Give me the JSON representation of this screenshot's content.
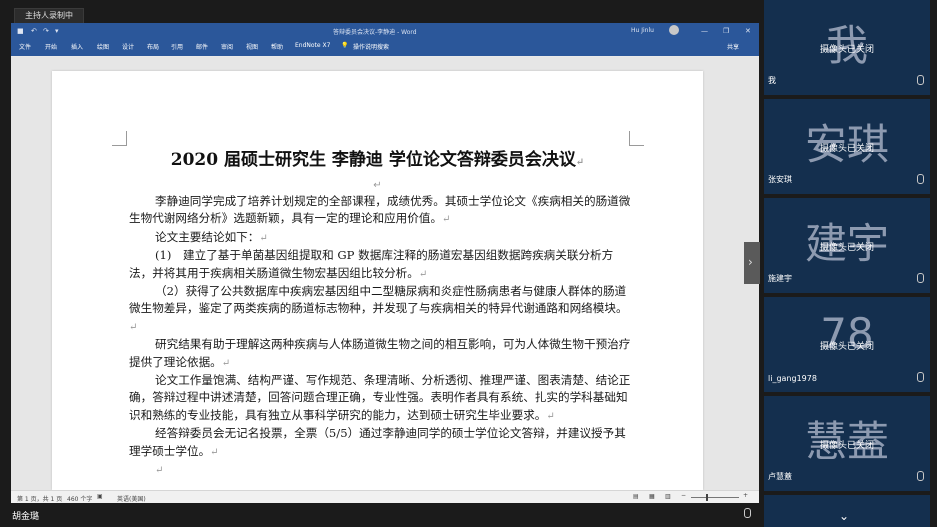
{
  "host_tab": "主持人录制中",
  "word": {
    "title": "答辩委员会决议-李静迪 - Word",
    "user": "Hu Jinlu",
    "share": "共享",
    "menu": [
      "文件",
      "开始",
      "插入",
      "绘图",
      "设计",
      "布局",
      "引用",
      "邮件",
      "审阅",
      "视图",
      "帮助",
      "EndNote X7"
    ],
    "tell_me": "操作说明搜索"
  },
  "document": {
    "title": "2020 届硕士研究生 李静迪 学位论文答辩委员会决议",
    "paragraphs": [
      "李静迪同学完成了培养计划规定的全部课程，成绩优秀。其硕士学位论文《疾病相关的肠道微生物代谢网络分析》选题新颖，具有一定的理论和应用价值。",
      "论文主要结论如下：",
      "(1)　建立了基于单菌基因组提取和 GP 数据库注释的肠道宏基因组数据跨疾病关联分析方法，并将其用于疾病相关肠道微生物宏基因组比较分析。",
      "（2）获得了公共数据库中疾病宏基因组中二型糖尿病和炎症性肠病患者与健康人群体的肠道微生物差异，鉴定了两类疾病的肠道标志物种，并发现了与疾病相关的特异代谢通路和网络模块。",
      "研究结果有助于理解这两种疾病与人体肠道微生物之间的相互影响，可为人体微生物干预治疗提供了理论依据。",
      "论文工作量饱满、结构严谨、写作规范、条理清晰、分析透彻、推理严谨、图表清楚、结论正确，答辩过程中讲述清楚，回答问题合理正确，专业性强。表明作者具有系统、扎实的学科基础知识和熟练的专业技能，具有独立从事科学研究的能力，达到硕士研究生毕业要求。",
      "经答辩委员会无记名投票，全票（5/5）通过李静迪同学的硕士学位论文答辩，并建议授予其理学硕士学位。"
    ]
  },
  "status_bar": {
    "page": "第 1 页，共 1 页",
    "words": "460 个字",
    "lang": "英语(美国)"
  },
  "participants": [
    {
      "avatar_text": "我",
      "camera_status": "摄像头已关闭",
      "name": "我"
    },
    {
      "avatar_text": "安琪",
      "camera_status": "摄像头已关闭",
      "name": "张安琪"
    },
    {
      "avatar_text": "建宇",
      "camera_status": "摄像头已关闭",
      "name": "施建宇"
    },
    {
      "avatar_text": "78",
      "camera_status": "摄像头已关闭",
      "name": "li_gang1978"
    },
    {
      "avatar_text": "慧蓋",
      "camera_status": "摄像头已关闭",
      "name": "卢慧蓋"
    }
  ],
  "bottom_user": "胡金璐",
  "colors": {
    "word_blue": "#2b579a",
    "tile_bg": "#142f4e",
    "app_bg": "#1b1b1b"
  }
}
